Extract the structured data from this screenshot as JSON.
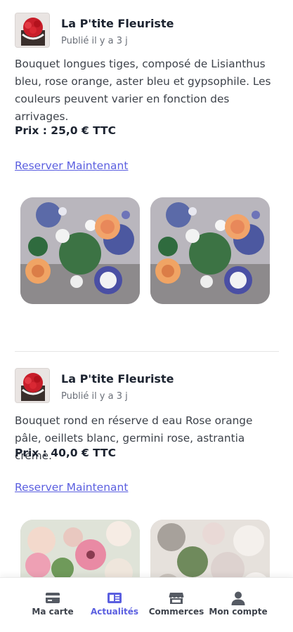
{
  "posts": [
    {
      "shop_name": "La P'tite Fleuriste",
      "posted_time": "Publié il y a 3 j",
      "description": "Bouquet longues tiges, composé de Lisianthus bleu, rose orange, aster bleu et gypsophile. Les couleurs peuvent varier en fonction des arrivages.",
      "price": "Prix : 25,0 € TTC",
      "reserve_label": "Reserver Maintenant"
    },
    {
      "shop_name": "La P'tite Fleuriste",
      "posted_time": "Publié il y a 3 j",
      "description": "Bouquet rond en réserve d eau Rose orange pâle, oeillets blanc, germini rose, astrantia crème.",
      "price": "Prix : 40,0 € TTC",
      "reserve_label": "Reserver Maintenant"
    }
  ],
  "bottom_nav": {
    "items": [
      {
        "label": "Ma carte",
        "icon": "card-icon",
        "active": false
      },
      {
        "label": "Actualités",
        "icon": "news-icon",
        "active": true
      },
      {
        "label": "Commerces",
        "icon": "store-icon",
        "active": false
      },
      {
        "label": "Mon compte",
        "icon": "user-icon",
        "active": false
      }
    ]
  },
  "colors": {
    "accent": "#5b5fe0",
    "text_dark": "#1c2330",
    "text_muted": "#6a6f78",
    "icon_gray": "#555a63"
  }
}
